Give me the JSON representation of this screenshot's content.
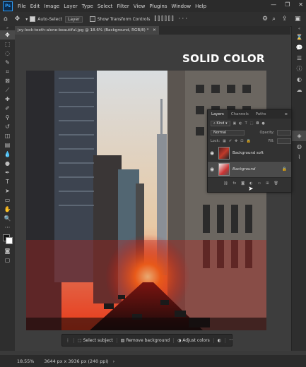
{
  "menu": {
    "items": [
      "File",
      "Edit",
      "Image",
      "Layer",
      "Type",
      "Select",
      "Filter",
      "View",
      "Plugins",
      "Window",
      "Help"
    ]
  },
  "options_bar": {
    "auto_select_label": "Auto-Select",
    "layer_select": "Layer",
    "transform_controls_label": "Show Transform Controls"
  },
  "document": {
    "tab_title": "joy-look-teeth-alone-beautiful.jpg @ 18.6% (Background, RGB/8) *",
    "overlay_title": "SOLID COLOR"
  },
  "layers_panel": {
    "tabs": [
      "Layers",
      "Channels",
      "Paths"
    ],
    "filter_kind": "Kind",
    "blend_mode": "Normal",
    "opacity_label": "Opacity:",
    "lock_label": "Lock:",
    "fill_label": "Fill:",
    "layers": [
      {
        "name": "Background soft",
        "selected": false
      },
      {
        "name": "Background",
        "selected": true
      }
    ]
  },
  "context_bar": {
    "select_subject": "Select subject",
    "remove_background": "Remove background",
    "adjust_colors": "Adjust colors"
  },
  "status": {
    "zoom": "18.55%",
    "doc_size": "3644 px x 3936 px (240 ppi)"
  },
  "colors": {
    "accent": "#2ea0ff",
    "panel": "#323232",
    "background": "#3a3a3a"
  }
}
